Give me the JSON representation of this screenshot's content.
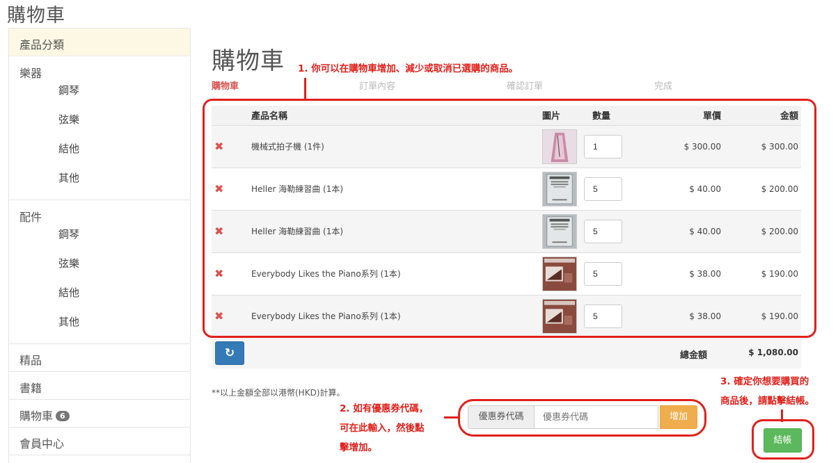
{
  "header": {
    "title": "購物車"
  },
  "sidebar": {
    "heading": "產品分類",
    "groups": [
      {
        "title": "樂器",
        "items": [
          "鋼琴",
          "弦樂",
          "結他",
          "其他"
        ]
      },
      {
        "title": "配件",
        "items": [
          "鋼琴",
          "弦樂",
          "結他",
          "其他"
        ]
      }
    ],
    "items": [
      {
        "label": "精品"
      },
      {
        "label": "書籍"
      },
      {
        "label": "購物車",
        "badge": "6"
      },
      {
        "label": "會員中心"
      }
    ]
  },
  "main": {
    "title": "購物車",
    "steps": [
      "購物車",
      "訂單內容",
      "確認訂單",
      "完成"
    ],
    "columns": {
      "name": "產品名稱",
      "image": "圖片",
      "qty": "數量",
      "price": "單價",
      "amount": "金額"
    },
    "rows": [
      {
        "name": "機械式拍子機 (1件)",
        "qty": "1",
        "price": "$ 300.00",
        "amount": "$ 300.00",
        "image": "metronome"
      },
      {
        "name": "Heller 海勒練習曲 (1本)",
        "qty": "5",
        "price": "$ 40.00",
        "amount": "$ 200.00",
        "image": "heller-book"
      },
      {
        "name": "Heller 海勒練習曲 (1本)",
        "qty": "5",
        "price": "$ 40.00",
        "amount": "$ 200.00",
        "image": "heller-book"
      },
      {
        "name": "Everybody Likes the Piano系列 (1本)",
        "qty": "5",
        "price": "$ 38.00",
        "amount": "$ 190.00",
        "image": "piano-book"
      },
      {
        "name": "Everybody Likes the Piano系列 (1本)",
        "qty": "5",
        "price": "$ 38.00",
        "amount": "$ 190.00",
        "image": "piano-book"
      }
    ],
    "total_label": "總金額",
    "total_value": "$ 1,080.00",
    "note": "**以上金額全部以港幣(HKD)計算。",
    "coupon": {
      "label": "優惠券代碼",
      "placeholder": "優惠券代碼",
      "button": "增加"
    },
    "checkout_button": "結帳"
  },
  "annotations": {
    "a1": "1. 你可以在購物車增加、減少或取消已選購的商品。",
    "a2_l1": "2. 如有優惠券代碼，",
    "a2_l2": "可在此輸入，然後點",
    "a2_l3": "擊增加。",
    "a3_l1": "3. 確定你想要購買的",
    "a3_l2": "商品後，請點擊結帳。"
  },
  "colors": {
    "annotation": "#e0201b",
    "checkout": "#5cb85c",
    "coupon_button": "#f0ad4e",
    "refresh": "#337ab7",
    "active_step": "#d9534f"
  }
}
